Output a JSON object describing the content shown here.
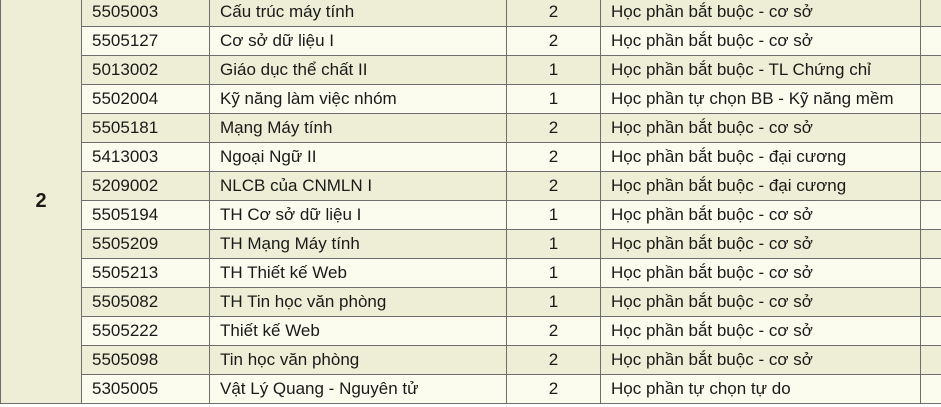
{
  "semester": "2",
  "courses": [
    {
      "code": "5505003",
      "name": "Cấu trúc máy tính",
      "credits": "2",
      "type": "Học phần bắt buộc - cơ sở"
    },
    {
      "code": "5505127",
      "name": "Cơ sở dữ liệu I",
      "credits": "2",
      "type": "Học phần bắt buộc - cơ sở"
    },
    {
      "code": "5013002",
      "name": "Giáo dục thể chất II",
      "credits": "1",
      "type": "Học phần bắt buộc - TL Chứng chỉ"
    },
    {
      "code": "5502004",
      "name": "Kỹ năng làm việc nhóm",
      "credits": "1",
      "type": "Học phần tự chọn BB - Kỹ năng mềm"
    },
    {
      "code": "5505181",
      "name": "Mạng Máy tính",
      "credits": "2",
      "type": "Học phần bắt buộc - cơ sở"
    },
    {
      "code": "5413003",
      "name": "Ngoại Ngữ II",
      "credits": "2",
      "type": "Học phần bắt buộc - đại cương"
    },
    {
      "code": "5209002",
      "name": "NLCB của CNMLN I",
      "credits": "2",
      "type": "Học phần bắt buộc - đại cương"
    },
    {
      "code": "5505194",
      "name": "TH Cơ sở dữ liệu I",
      "credits": "1",
      "type": "Học phần bắt buộc - cơ sở"
    },
    {
      "code": "5505209",
      "name": "TH Mạng Máy tính",
      "credits": "1",
      "type": "Học phần bắt buộc - cơ sở"
    },
    {
      "code": "5505213",
      "name": "TH Thiết kế Web",
      "credits": "1",
      "type": "Học phần bắt buộc - cơ sở"
    },
    {
      "code": "5505082",
      "name": "TH Tin học văn phòng",
      "credits": "1",
      "type": "Học phần bắt buộc - cơ sở"
    },
    {
      "code": "5505222",
      "name": "Thiết kế Web",
      "credits": "2",
      "type": "Học phần bắt buộc - cơ sở"
    },
    {
      "code": "5505098",
      "name": "Tin học văn phòng",
      "credits": "2",
      "type": "Học phần bắt buộc - cơ sở"
    },
    {
      "code": "5305005",
      "name": "Vật Lý Quang - Nguyên tử",
      "credits": "2",
      "type": "Học phần tự chọn tự do"
    }
  ]
}
